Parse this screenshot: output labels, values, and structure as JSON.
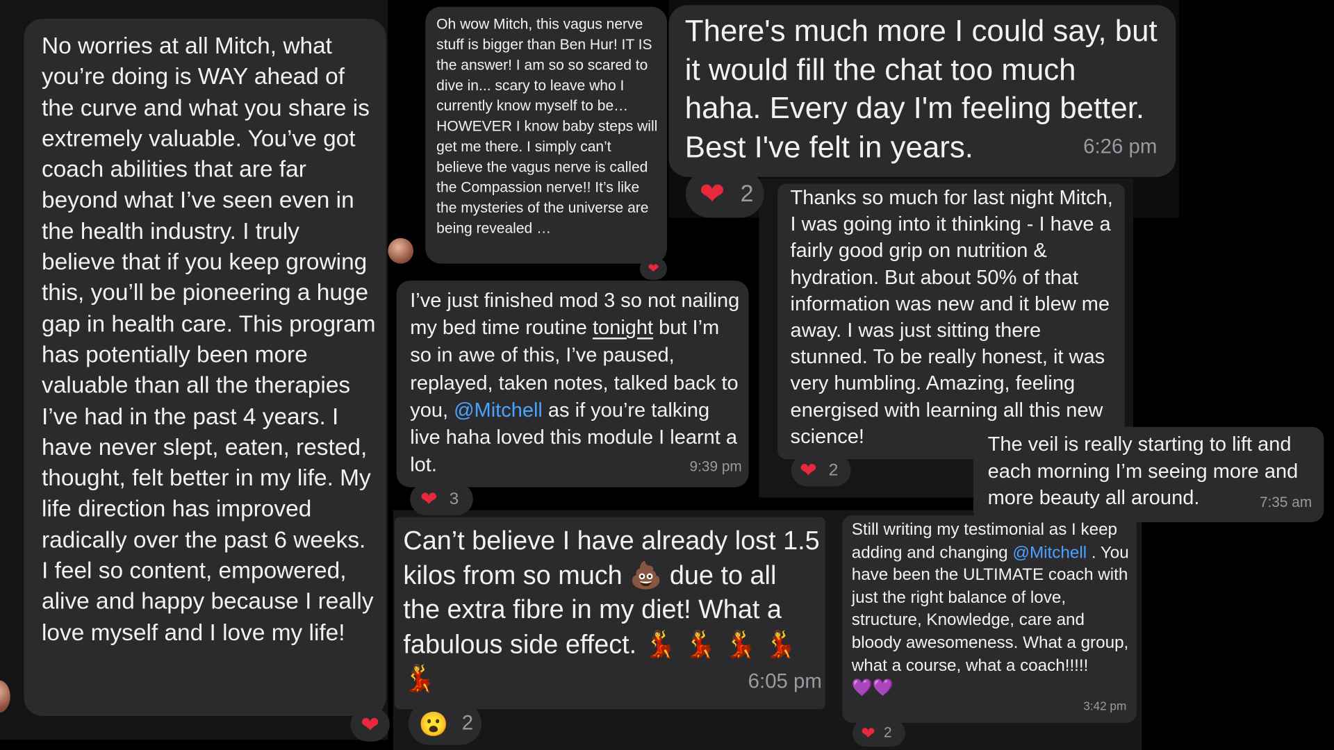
{
  "colors": {
    "background": "#000000",
    "bubble": "#2b2b2e",
    "mention": "#4aa3ff",
    "heart": "#e8283b",
    "purple_heart": "#9b59d0"
  },
  "icons": {
    "heart": "heart-icon",
    "poop": "pile-of-poo-emoji",
    "dancer": "dancer-emoji",
    "surprised": "surprised-face-emoji",
    "purple_heart": "purple-heart-emoji"
  },
  "msg1": {
    "text": "No worries at all Mitch, what you’re doing is WAY ahead of the curve and what you share is extremely valuable. You’ve got coach abilities that are far beyond what I’ve seen even in the health industry. I truly believe that if you keep growing this, you’ll be pioneering a huge gap in health care. This program has potentially been more valuable than all the therapies I’ve had in the past 4 years. I have never slept, eaten, rested, thought, felt better in my life. My life direction has improved radically over the past 6 weeks. I feel so content, empowered, alive and happy because I really love myself and I love my life!"
  },
  "msg2": {
    "text": "Oh wow Mitch, this vagus nerve stuff is bigger than Ben Hur! IT IS the answer! I am so so scared to dive in... scary to leave who I currently know myself to be… HOWEVER I know baby steps will get me there. I simply can’t believe the vagus nerve is called the Compassion nerve!! It’s like the mysteries of the universe are being revealed …"
  },
  "msg3": {
    "text": "There's much more I could say, but it would fill the chat too much haha. Every day I'm feeling better. Best I've felt in years.",
    "time": "6:26 pm",
    "reaction_count": "2"
  },
  "msg4": {
    "text_a": "I’ve just finished mod 3 so not nailing my bed time routine ",
    "text_underlined": "tonight",
    "text_b": " but I’m so in awe of this, I’ve paused, replayed, taken notes, talked back to you, ",
    "mention": "@Mitchell",
    "text_c": " as if you’re talking live haha loved this module I learnt a lot.",
    "time": "9:39 pm",
    "reaction_count": "3"
  },
  "msg5": {
    "text": "Thanks so much for last night Mitch, I was going into it thinking - I have a fairly good grip on nutrition & hydration. But about 50% of that information was new and it blew me away. I was just sitting there stunned. To be really honest, it was very humbling. Amazing, feeling energised with learning all this new science!",
    "reaction_count": "2"
  },
  "msg6": {
    "text": "The veil is really starting to lift and each morning I’m seeing more and more beauty all around.",
    "time": "7:35 am"
  },
  "msg7": {
    "text_a": "Can’t believe I have already lost 1.5 kilos from so much ",
    "text_b": " due to all the extra fibre in my diet! What a fabulous side effect. ",
    "time": "6:05 pm",
    "reaction_count": "2"
  },
  "msg8": {
    "text_a": "Still writing my testimonial as I keep adding and changing ",
    "mention": "@Mitchell",
    "text_b": " . You have been the ULTIMATE coach with just the right balance of love, structure, Knowledge, care and bloody awesomeness. What a group, what a course, what a coach!!!!! ",
    "time": "3:42 pm",
    "reaction_count": "2"
  }
}
